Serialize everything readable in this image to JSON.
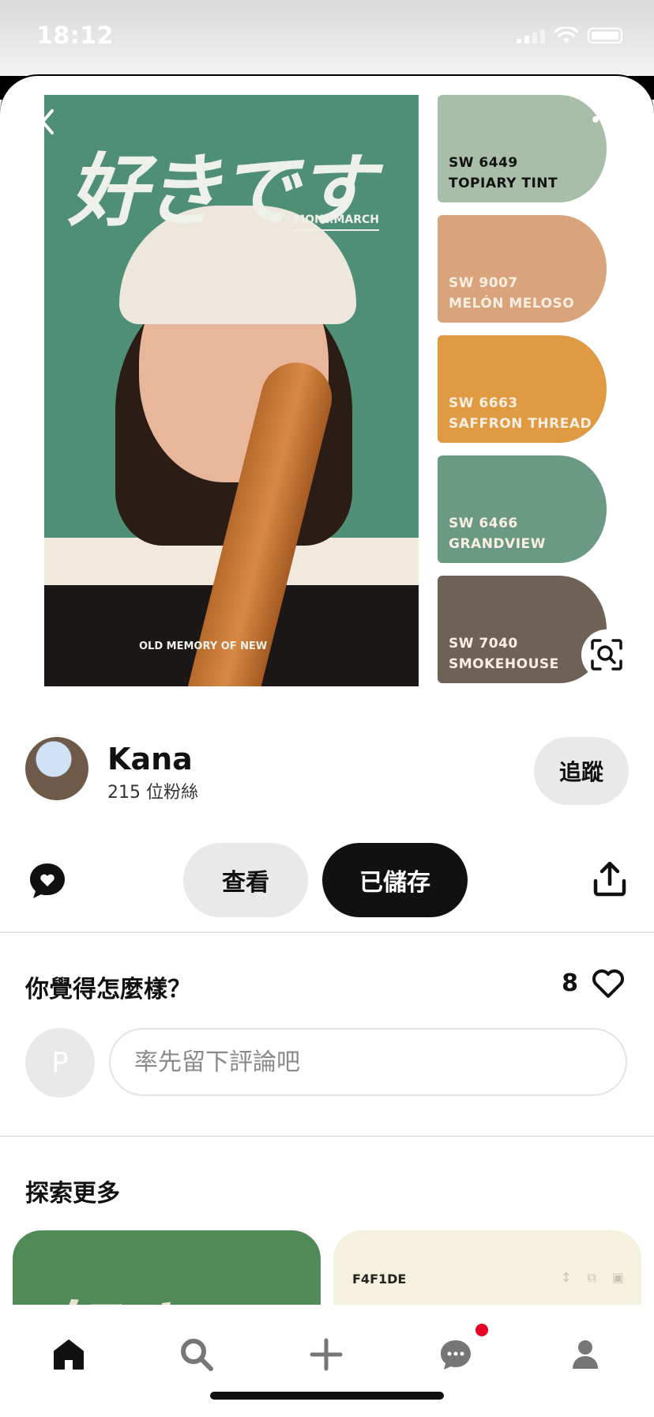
{
  "status_bar": {
    "time": "18:12"
  },
  "pin": {
    "poster": {
      "title": "好きです",
      "subtitle": "MONT.MARCH",
      "footer_text": "OLD MEMORY OF NEW"
    },
    "swatches": [
      {
        "code": "SW 6449",
        "name": "TOPIARY TINT",
        "color": "#a8bea8"
      },
      {
        "code": "SW 9007",
        "name": "MELÓN MELOSO",
        "color": "#d9a47c"
      },
      {
        "code": "SW 6663",
        "name": "SAFFRON THREAD",
        "color": "#e09a42"
      },
      {
        "code": "SW 6466",
        "name": "GRANDVIEW",
        "color": "#6b9a84"
      },
      {
        "code": "SW 7040",
        "name": "SMOKEHOUSE",
        "color": "#6e6156"
      }
    ]
  },
  "creator": {
    "name": "Kana",
    "followers": "215 位粉絲",
    "follow_label": "追蹤"
  },
  "actions": {
    "view_label": "查看",
    "saved_label": "已儲存"
  },
  "comments": {
    "title": "你覺得怎麼樣？",
    "like_count": "8",
    "avatar_initial": "P",
    "input_placeholder": "率先留下評論吧"
  },
  "explore": {
    "title": "探索更多",
    "card2_hex": "F4F1DE"
  },
  "colors": {
    "accent_red": "#e60023",
    "saved_button_bg": "#111111",
    "poster_green": "#4f8f75"
  }
}
